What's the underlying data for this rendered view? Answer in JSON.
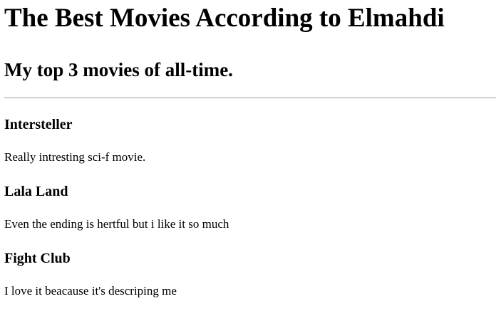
{
  "header": {
    "title": "The Best Movies According to Elmahdi",
    "subtitle": "My top 3 movies of all-time."
  },
  "movies": [
    {
      "title": "Intersteller",
      "description": "Really intresting sci-f movie."
    },
    {
      "title": "Lala Land",
      "description": "Even the ending is hertful but i like it so much"
    },
    {
      "title": "Fight Club",
      "description": "I love it beacause it's descriping me"
    }
  ]
}
